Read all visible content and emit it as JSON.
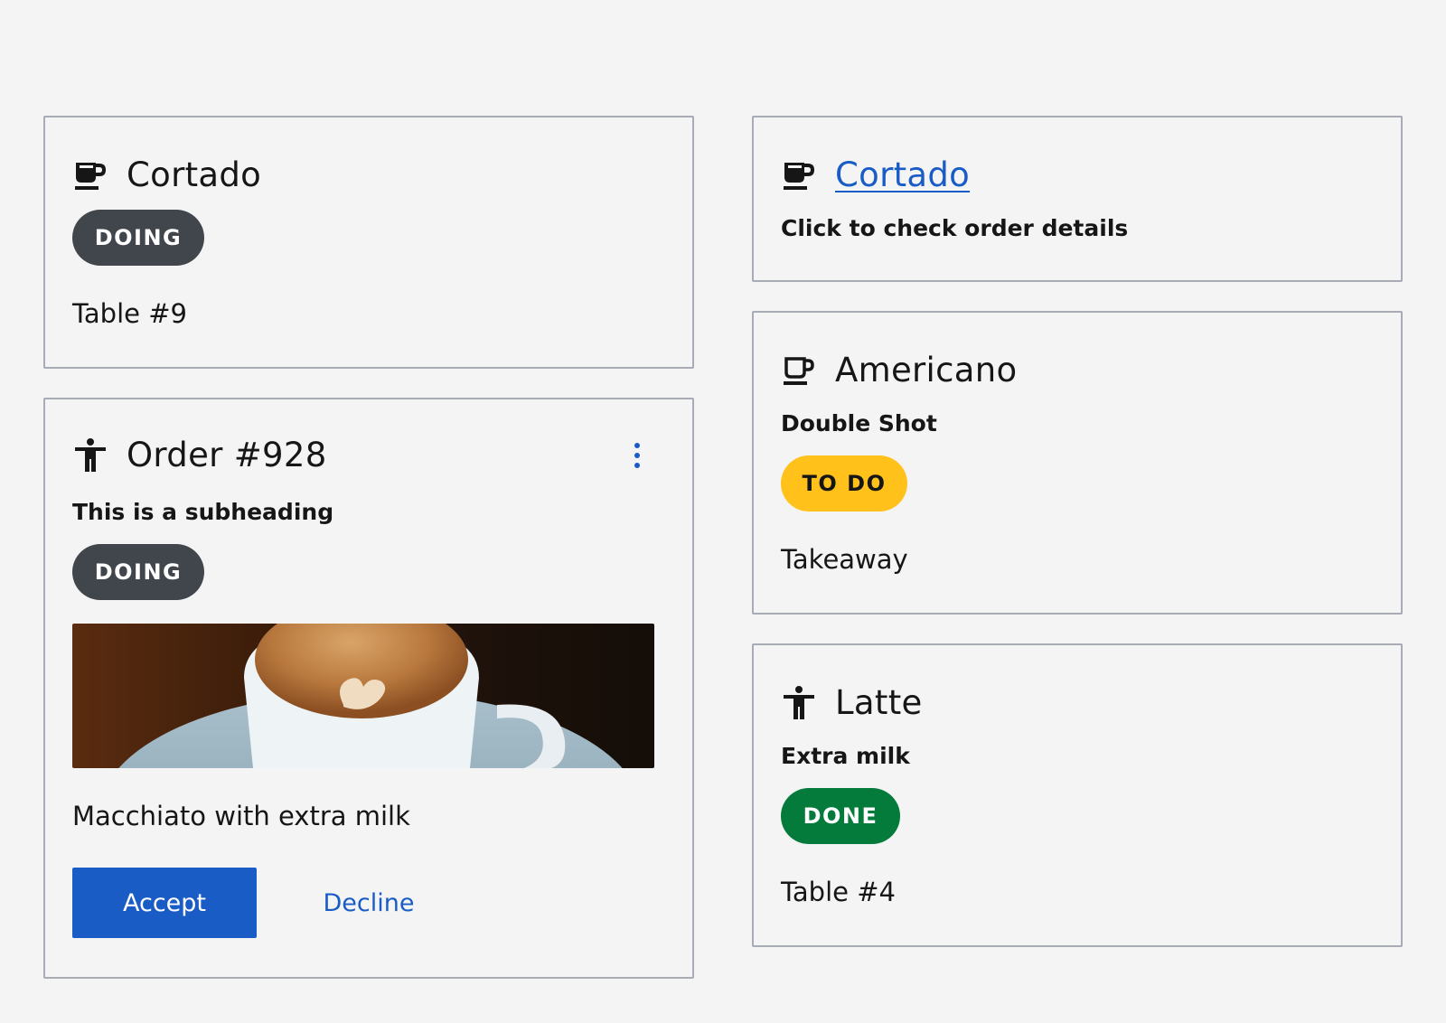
{
  "colors": {
    "background": "#f4f4f4",
    "border": "#a8abb3",
    "link": "#1a5cc6",
    "doing_badge": "#41454c",
    "todo_badge": "#ffc11a",
    "done_badge": "#047a3b"
  },
  "cards": {
    "cortado": {
      "icon": "coffee-cup-filled-icon",
      "title": "Cortado",
      "badge": "DOING",
      "text": "Table #9"
    },
    "order": {
      "icon": "person-icon",
      "title": "Order #928",
      "subheading": "This is a subheading",
      "badge": "DOING",
      "menu_icon": "overflow-menu-vertical-icon",
      "image": "coffee-latte-art-photo",
      "text": "Macchiato with extra milk",
      "accept_label": "Accept",
      "decline_label": "Decline"
    },
    "cortado_link": {
      "icon": "coffee-cup-filled-icon",
      "title": "Cortado",
      "subheading": "Click to check order details"
    },
    "americano": {
      "icon": "coffee-cup-outline-icon",
      "title": "Americano",
      "subheading": "Double Shot",
      "badge": "TO DO",
      "text": "Takeaway"
    },
    "latte": {
      "icon": "person-icon",
      "title": "Latte",
      "subheading": "Extra milk",
      "badge": "DONE",
      "text": "Table #4"
    }
  }
}
